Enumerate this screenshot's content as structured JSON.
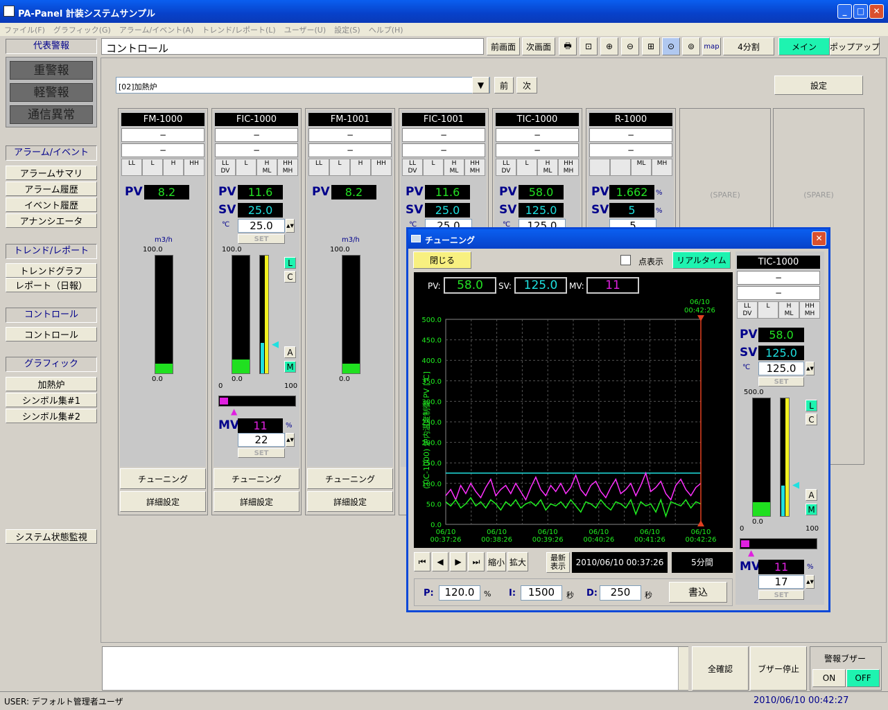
{
  "window": {
    "title": "PA-Panel 計装システムサンプル"
  },
  "menu": [
    "ファイル(F)",
    "グラフィック(G)",
    "アラーム/イベント(A)",
    "トレンド/レポート(L)",
    "ユーザー(U)",
    "設定(S)",
    "ヘルプ(H)"
  ],
  "toolbar": {
    "screen_title": "コントロール",
    "prev_screen": "前画面",
    "next_screen": "次画面",
    "map": "map",
    "split": "4分割",
    "main": "メイン",
    "popup": "ポップアップ"
  },
  "sidebar": {
    "rep_alarm": "代表警報",
    "heavy": "重警報",
    "light": "軽警報",
    "comm": "通信異常",
    "g1": "アラーム/イベント",
    "alarm_summary": "アラームサマリ",
    "alarm_hist": "アラーム履歴",
    "event_hist": "イベント履歴",
    "annunciator": "アナンシエータ",
    "g2": "トレンド/レポート",
    "trend_graph": "トレンドグラフ",
    "report": "レポート（日報）",
    "g3": "コントロール",
    "control": "コントロール",
    "g4": "グラフィック",
    "furnace": "加熱炉",
    "sym1": "シンボル集#1",
    "sym2": "シンボル集#2",
    "sysmon": "システム状態監視"
  },
  "control": {
    "combo": "[02]加熱炉",
    "prev": "前",
    "next": "次",
    "settings": "設定",
    "spare": "(SPARE)",
    "tuning": "チューニング",
    "detail": "詳細設定",
    "set": "SET",
    "dash": "−"
  },
  "lim4": [
    "LL",
    "L",
    "H",
    "HH"
  ],
  "lim6": [
    "LL\nDV",
    "L",
    "H\nML",
    "HH\nMH"
  ],
  "limR": [
    "",
    "",
    "ML",
    "MH"
  ],
  "panels": [
    {
      "tag": "FM-1000",
      "pv": "8.2",
      "unit": "m3/h",
      "max": "100.0",
      "min": "0.0"
    },
    {
      "tag": "FIC-1000",
      "pv": "11.6",
      "sv": "25.0",
      "sv_in": "25.0",
      "unit": "℃",
      "max": "100.0",
      "min": "0.0",
      "mv": "11",
      "mv_in": "22",
      "mv_unit": "%",
      "mv_lo": "0",
      "mv_hi": "100"
    },
    {
      "tag": "FM-1001",
      "pv": "8.2",
      "unit": "m3/h",
      "max": "100.0",
      "min": "0.0"
    },
    {
      "tag": "FIC-1001",
      "pv": "11.6",
      "sv": "25.0",
      "sv_in": "25.0",
      "unit": "℃"
    },
    {
      "tag": "TIC-1000",
      "pv": "58.0",
      "sv": "125.0",
      "sv_in": "125.0",
      "unit": "℃"
    },
    {
      "tag": "R-1000",
      "pv": "1.662",
      "sv": "5",
      "sv_in": "5",
      "unit": "%"
    }
  ],
  "labels": {
    "pv": "PV",
    "sv": "SV",
    "mv": "MV",
    "L": "L",
    "C": "C",
    "A": "A",
    "M": "M"
  },
  "dialog": {
    "title": "チューニング",
    "close": "閉じる",
    "point": "点表示",
    "realtime": "リアルタイム",
    "pv_label": "PV:",
    "pv": "58.0",
    "sv_label": "SV:",
    "sv": "125.0",
    "mv_label": "MV:",
    "mv": "11",
    "cursor_time": "06/10\n00:42:26",
    "ylabel": "(TIC-1000) 炉内温度制御 PV [℃]",
    "yticks": [
      "500.0",
      "450.0",
      "400.0",
      "350.0",
      "300.0",
      "250.0",
      "200.0",
      "150.0",
      "100.0",
      "50.0",
      "0.0"
    ],
    "xticks": [
      "06/10\n00:37:26",
      "06/10\n00:38:26",
      "06/10\n00:39:26",
      "06/10\n00:40:26",
      "06/10\n00:41:26",
      "06/10\n00:42:26"
    ],
    "shrink": "縮小",
    "expand": "拡大",
    "latest": "最新\n表示",
    "start_time": "2010/06/10 00:37:26",
    "span": "5分間",
    "p_label": "P:",
    "p": "120.0",
    "p_unit": "%",
    "i_label": "I:",
    "i": "1500",
    "i_unit": "秒",
    "d_label": "D:",
    "d": "250",
    "d_unit": "秒",
    "write": "書込",
    "faceplate": {
      "tag": "TIC-1000",
      "pv": "58.0",
      "sv": "125.0",
      "sv_in": "125.0",
      "unit": "℃",
      "max": "500.0",
      "min": "0.0",
      "mv": "11",
      "mv_in": "17",
      "mv_unit": "%",
      "mv_lo": "0",
      "mv_hi": "100"
    }
  },
  "bottom": {
    "ack_all": "全確認",
    "buzzer_stop": "ブザー停止",
    "buzzer": "警報ブザー",
    "on": "ON",
    "off": "OFF"
  },
  "status": {
    "user": "USER: デフォルト管理者ユーザ",
    "time": "2010/06/10 00:42:27"
  },
  "chart_data": {
    "type": "line",
    "yrange": [
      0,
      500
    ],
    "sv_line": 125,
    "series": [
      {
        "color": "#ff30ff",
        "values": [
          70,
          85,
          60,
          95,
          75,
          100,
          80,
          65,
          90,
          110,
          70,
          85,
          95,
          75,
          100,
          80,
          60,
          90,
          115,
          85,
          70,
          95,
          80,
          100,
          75,
          90,
          120,
          85,
          70,
          95,
          105,
          80,
          65,
          90,
          110,
          75,
          85,
          100,
          70,
          95,
          125,
          80,
          90,
          105,
          75,
          60,
          95,
          110,
          85,
          70,
          90,
          100
        ]
      },
      {
        "color": "#20ee20",
        "values": [
          55,
          45,
          60,
          40,
          50,
          65,
          45,
          55,
          40,
          60,
          50,
          35,
          55,
          45,
          60,
          40,
          50,
          55,
          45,
          60,
          35,
          50,
          45,
          55,
          40,
          60,
          45,
          30,
          55,
          50,
          40,
          60,
          45,
          35,
          55,
          50,
          40,
          60,
          25,
          55,
          45,
          50,
          30,
          60,
          20,
          55,
          50,
          45,
          60,
          40,
          55,
          50
        ]
      }
    ]
  }
}
